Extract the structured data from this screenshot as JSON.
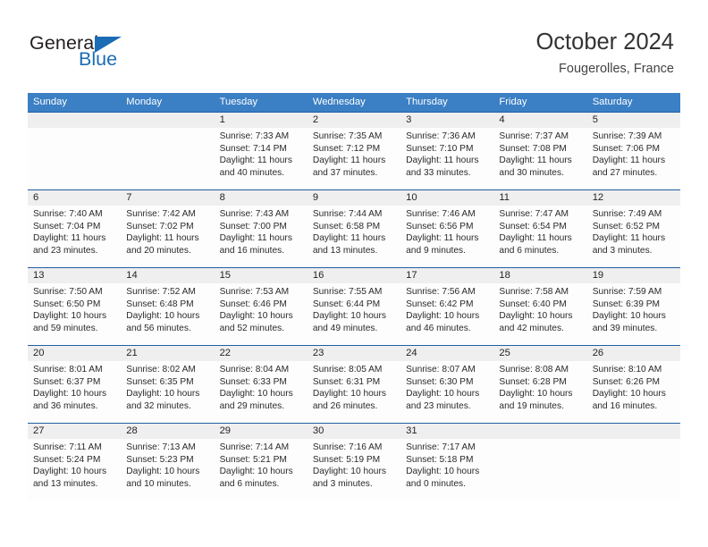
{
  "brand": {
    "name_part1": "General",
    "name_part2": "Blue",
    "logo_icon": "triangle-logo-icon"
  },
  "header": {
    "title": "October 2024",
    "subtitle": "Fougerolles, France"
  },
  "colors": {
    "header_blue": "#3b7fc4",
    "row_separator_blue": "#1f5fa4",
    "brand_blue": "#1b6cb5",
    "day_band_gray": "#efefef"
  },
  "weekdays": [
    "Sunday",
    "Monday",
    "Tuesday",
    "Wednesday",
    "Thursday",
    "Friday",
    "Saturday"
  ],
  "weeks": [
    [
      {
        "day": "",
        "sunrise": "",
        "sunset": "",
        "daylight": "",
        "daylight2": ""
      },
      {
        "day": "",
        "sunrise": "",
        "sunset": "",
        "daylight": "",
        "daylight2": ""
      },
      {
        "day": "1",
        "sunrise": "Sunrise: 7:33 AM",
        "sunset": "Sunset: 7:14 PM",
        "daylight": "Daylight: 11 hours",
        "daylight2": "and 40 minutes."
      },
      {
        "day": "2",
        "sunrise": "Sunrise: 7:35 AM",
        "sunset": "Sunset: 7:12 PM",
        "daylight": "Daylight: 11 hours",
        "daylight2": "and 37 minutes."
      },
      {
        "day": "3",
        "sunrise": "Sunrise: 7:36 AM",
        "sunset": "Sunset: 7:10 PM",
        "daylight": "Daylight: 11 hours",
        "daylight2": "and 33 minutes."
      },
      {
        "day": "4",
        "sunrise": "Sunrise: 7:37 AM",
        "sunset": "Sunset: 7:08 PM",
        "daylight": "Daylight: 11 hours",
        "daylight2": "and 30 minutes."
      },
      {
        "day": "5",
        "sunrise": "Sunrise: 7:39 AM",
        "sunset": "Sunset: 7:06 PM",
        "daylight": "Daylight: 11 hours",
        "daylight2": "and 27 minutes."
      }
    ],
    [
      {
        "day": "6",
        "sunrise": "Sunrise: 7:40 AM",
        "sunset": "Sunset: 7:04 PM",
        "daylight": "Daylight: 11 hours",
        "daylight2": "and 23 minutes."
      },
      {
        "day": "7",
        "sunrise": "Sunrise: 7:42 AM",
        "sunset": "Sunset: 7:02 PM",
        "daylight": "Daylight: 11 hours",
        "daylight2": "and 20 minutes."
      },
      {
        "day": "8",
        "sunrise": "Sunrise: 7:43 AM",
        "sunset": "Sunset: 7:00 PM",
        "daylight": "Daylight: 11 hours",
        "daylight2": "and 16 minutes."
      },
      {
        "day": "9",
        "sunrise": "Sunrise: 7:44 AM",
        "sunset": "Sunset: 6:58 PM",
        "daylight": "Daylight: 11 hours",
        "daylight2": "and 13 minutes."
      },
      {
        "day": "10",
        "sunrise": "Sunrise: 7:46 AM",
        "sunset": "Sunset: 6:56 PM",
        "daylight": "Daylight: 11 hours",
        "daylight2": "and 9 minutes."
      },
      {
        "day": "11",
        "sunrise": "Sunrise: 7:47 AM",
        "sunset": "Sunset: 6:54 PM",
        "daylight": "Daylight: 11 hours",
        "daylight2": "and 6 minutes."
      },
      {
        "day": "12",
        "sunrise": "Sunrise: 7:49 AM",
        "sunset": "Sunset: 6:52 PM",
        "daylight": "Daylight: 11 hours",
        "daylight2": "and 3 minutes."
      }
    ],
    [
      {
        "day": "13",
        "sunrise": "Sunrise: 7:50 AM",
        "sunset": "Sunset: 6:50 PM",
        "daylight": "Daylight: 10 hours",
        "daylight2": "and 59 minutes."
      },
      {
        "day": "14",
        "sunrise": "Sunrise: 7:52 AM",
        "sunset": "Sunset: 6:48 PM",
        "daylight": "Daylight: 10 hours",
        "daylight2": "and 56 minutes."
      },
      {
        "day": "15",
        "sunrise": "Sunrise: 7:53 AM",
        "sunset": "Sunset: 6:46 PM",
        "daylight": "Daylight: 10 hours",
        "daylight2": "and 52 minutes."
      },
      {
        "day": "16",
        "sunrise": "Sunrise: 7:55 AM",
        "sunset": "Sunset: 6:44 PM",
        "daylight": "Daylight: 10 hours",
        "daylight2": "and 49 minutes."
      },
      {
        "day": "17",
        "sunrise": "Sunrise: 7:56 AM",
        "sunset": "Sunset: 6:42 PM",
        "daylight": "Daylight: 10 hours",
        "daylight2": "and 46 minutes."
      },
      {
        "day": "18",
        "sunrise": "Sunrise: 7:58 AM",
        "sunset": "Sunset: 6:40 PM",
        "daylight": "Daylight: 10 hours",
        "daylight2": "and 42 minutes."
      },
      {
        "day": "19",
        "sunrise": "Sunrise: 7:59 AM",
        "sunset": "Sunset: 6:39 PM",
        "daylight": "Daylight: 10 hours",
        "daylight2": "and 39 minutes."
      }
    ],
    [
      {
        "day": "20",
        "sunrise": "Sunrise: 8:01 AM",
        "sunset": "Sunset: 6:37 PM",
        "daylight": "Daylight: 10 hours",
        "daylight2": "and 36 minutes."
      },
      {
        "day": "21",
        "sunrise": "Sunrise: 8:02 AM",
        "sunset": "Sunset: 6:35 PM",
        "daylight": "Daylight: 10 hours",
        "daylight2": "and 32 minutes."
      },
      {
        "day": "22",
        "sunrise": "Sunrise: 8:04 AM",
        "sunset": "Sunset: 6:33 PM",
        "daylight": "Daylight: 10 hours",
        "daylight2": "and 29 minutes."
      },
      {
        "day": "23",
        "sunrise": "Sunrise: 8:05 AM",
        "sunset": "Sunset: 6:31 PM",
        "daylight": "Daylight: 10 hours",
        "daylight2": "and 26 minutes."
      },
      {
        "day": "24",
        "sunrise": "Sunrise: 8:07 AM",
        "sunset": "Sunset: 6:30 PM",
        "daylight": "Daylight: 10 hours",
        "daylight2": "and 23 minutes."
      },
      {
        "day": "25",
        "sunrise": "Sunrise: 8:08 AM",
        "sunset": "Sunset: 6:28 PM",
        "daylight": "Daylight: 10 hours",
        "daylight2": "and 19 minutes."
      },
      {
        "day": "26",
        "sunrise": "Sunrise: 8:10 AM",
        "sunset": "Sunset: 6:26 PM",
        "daylight": "Daylight: 10 hours",
        "daylight2": "and 16 minutes."
      }
    ],
    [
      {
        "day": "27",
        "sunrise": "Sunrise: 7:11 AM",
        "sunset": "Sunset: 5:24 PM",
        "daylight": "Daylight: 10 hours",
        "daylight2": "and 13 minutes."
      },
      {
        "day": "28",
        "sunrise": "Sunrise: 7:13 AM",
        "sunset": "Sunset: 5:23 PM",
        "daylight": "Daylight: 10 hours",
        "daylight2": "and 10 minutes."
      },
      {
        "day": "29",
        "sunrise": "Sunrise: 7:14 AM",
        "sunset": "Sunset: 5:21 PM",
        "daylight": "Daylight: 10 hours",
        "daylight2": "and 6 minutes."
      },
      {
        "day": "30",
        "sunrise": "Sunrise: 7:16 AM",
        "sunset": "Sunset: 5:19 PM",
        "daylight": "Daylight: 10 hours",
        "daylight2": "and 3 minutes."
      },
      {
        "day": "31",
        "sunrise": "Sunrise: 7:17 AM",
        "sunset": "Sunset: 5:18 PM",
        "daylight": "Daylight: 10 hours",
        "daylight2": "and 0 minutes."
      },
      {
        "day": "",
        "sunrise": "",
        "sunset": "",
        "daylight": "",
        "daylight2": ""
      },
      {
        "day": "",
        "sunrise": "",
        "sunset": "",
        "daylight": "",
        "daylight2": ""
      }
    ]
  ]
}
